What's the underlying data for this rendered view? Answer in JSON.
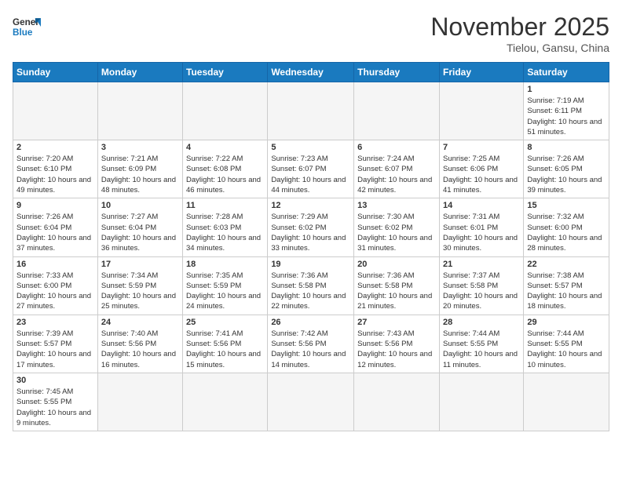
{
  "logo": {
    "text_general": "General",
    "text_blue": "Blue"
  },
  "header": {
    "month_title": "November 2025",
    "subtitle": "Tielou, Gansu, China"
  },
  "weekdays": [
    "Sunday",
    "Monday",
    "Tuesday",
    "Wednesday",
    "Thursday",
    "Friday",
    "Saturday"
  ],
  "weeks": [
    [
      {
        "day": "",
        "info": ""
      },
      {
        "day": "",
        "info": ""
      },
      {
        "day": "",
        "info": ""
      },
      {
        "day": "",
        "info": ""
      },
      {
        "day": "",
        "info": ""
      },
      {
        "day": "",
        "info": ""
      },
      {
        "day": "1",
        "info": "Sunrise: 7:19 AM\nSunset: 6:11 PM\nDaylight: 10 hours and 51 minutes."
      }
    ],
    [
      {
        "day": "2",
        "info": "Sunrise: 7:20 AM\nSunset: 6:10 PM\nDaylight: 10 hours and 49 minutes."
      },
      {
        "day": "3",
        "info": "Sunrise: 7:21 AM\nSunset: 6:09 PM\nDaylight: 10 hours and 48 minutes."
      },
      {
        "day": "4",
        "info": "Sunrise: 7:22 AM\nSunset: 6:08 PM\nDaylight: 10 hours and 46 minutes."
      },
      {
        "day": "5",
        "info": "Sunrise: 7:23 AM\nSunset: 6:07 PM\nDaylight: 10 hours and 44 minutes."
      },
      {
        "day": "6",
        "info": "Sunrise: 7:24 AM\nSunset: 6:07 PM\nDaylight: 10 hours and 42 minutes."
      },
      {
        "day": "7",
        "info": "Sunrise: 7:25 AM\nSunset: 6:06 PM\nDaylight: 10 hours and 41 minutes."
      },
      {
        "day": "8",
        "info": "Sunrise: 7:26 AM\nSunset: 6:05 PM\nDaylight: 10 hours and 39 minutes."
      }
    ],
    [
      {
        "day": "9",
        "info": "Sunrise: 7:26 AM\nSunset: 6:04 PM\nDaylight: 10 hours and 37 minutes."
      },
      {
        "day": "10",
        "info": "Sunrise: 7:27 AM\nSunset: 6:04 PM\nDaylight: 10 hours and 36 minutes."
      },
      {
        "day": "11",
        "info": "Sunrise: 7:28 AM\nSunset: 6:03 PM\nDaylight: 10 hours and 34 minutes."
      },
      {
        "day": "12",
        "info": "Sunrise: 7:29 AM\nSunset: 6:02 PM\nDaylight: 10 hours and 33 minutes."
      },
      {
        "day": "13",
        "info": "Sunrise: 7:30 AM\nSunset: 6:02 PM\nDaylight: 10 hours and 31 minutes."
      },
      {
        "day": "14",
        "info": "Sunrise: 7:31 AM\nSunset: 6:01 PM\nDaylight: 10 hours and 30 minutes."
      },
      {
        "day": "15",
        "info": "Sunrise: 7:32 AM\nSunset: 6:00 PM\nDaylight: 10 hours and 28 minutes."
      }
    ],
    [
      {
        "day": "16",
        "info": "Sunrise: 7:33 AM\nSunset: 6:00 PM\nDaylight: 10 hours and 27 minutes."
      },
      {
        "day": "17",
        "info": "Sunrise: 7:34 AM\nSunset: 5:59 PM\nDaylight: 10 hours and 25 minutes."
      },
      {
        "day": "18",
        "info": "Sunrise: 7:35 AM\nSunset: 5:59 PM\nDaylight: 10 hours and 24 minutes."
      },
      {
        "day": "19",
        "info": "Sunrise: 7:36 AM\nSunset: 5:58 PM\nDaylight: 10 hours and 22 minutes."
      },
      {
        "day": "20",
        "info": "Sunrise: 7:36 AM\nSunset: 5:58 PM\nDaylight: 10 hours and 21 minutes."
      },
      {
        "day": "21",
        "info": "Sunrise: 7:37 AM\nSunset: 5:58 PM\nDaylight: 10 hours and 20 minutes."
      },
      {
        "day": "22",
        "info": "Sunrise: 7:38 AM\nSunset: 5:57 PM\nDaylight: 10 hours and 18 minutes."
      }
    ],
    [
      {
        "day": "23",
        "info": "Sunrise: 7:39 AM\nSunset: 5:57 PM\nDaylight: 10 hours and 17 minutes."
      },
      {
        "day": "24",
        "info": "Sunrise: 7:40 AM\nSunset: 5:56 PM\nDaylight: 10 hours and 16 minutes."
      },
      {
        "day": "25",
        "info": "Sunrise: 7:41 AM\nSunset: 5:56 PM\nDaylight: 10 hours and 15 minutes."
      },
      {
        "day": "26",
        "info": "Sunrise: 7:42 AM\nSunset: 5:56 PM\nDaylight: 10 hours and 14 minutes."
      },
      {
        "day": "27",
        "info": "Sunrise: 7:43 AM\nSunset: 5:56 PM\nDaylight: 10 hours and 12 minutes."
      },
      {
        "day": "28",
        "info": "Sunrise: 7:44 AM\nSunset: 5:55 PM\nDaylight: 10 hours and 11 minutes."
      },
      {
        "day": "29",
        "info": "Sunrise: 7:44 AM\nSunset: 5:55 PM\nDaylight: 10 hours and 10 minutes."
      }
    ],
    [
      {
        "day": "30",
        "info": "Sunrise: 7:45 AM\nSunset: 5:55 PM\nDaylight: 10 hours and 9 minutes."
      },
      {
        "day": "",
        "info": ""
      },
      {
        "day": "",
        "info": ""
      },
      {
        "day": "",
        "info": ""
      },
      {
        "day": "",
        "info": ""
      },
      {
        "day": "",
        "info": ""
      },
      {
        "day": "",
        "info": ""
      }
    ]
  ]
}
